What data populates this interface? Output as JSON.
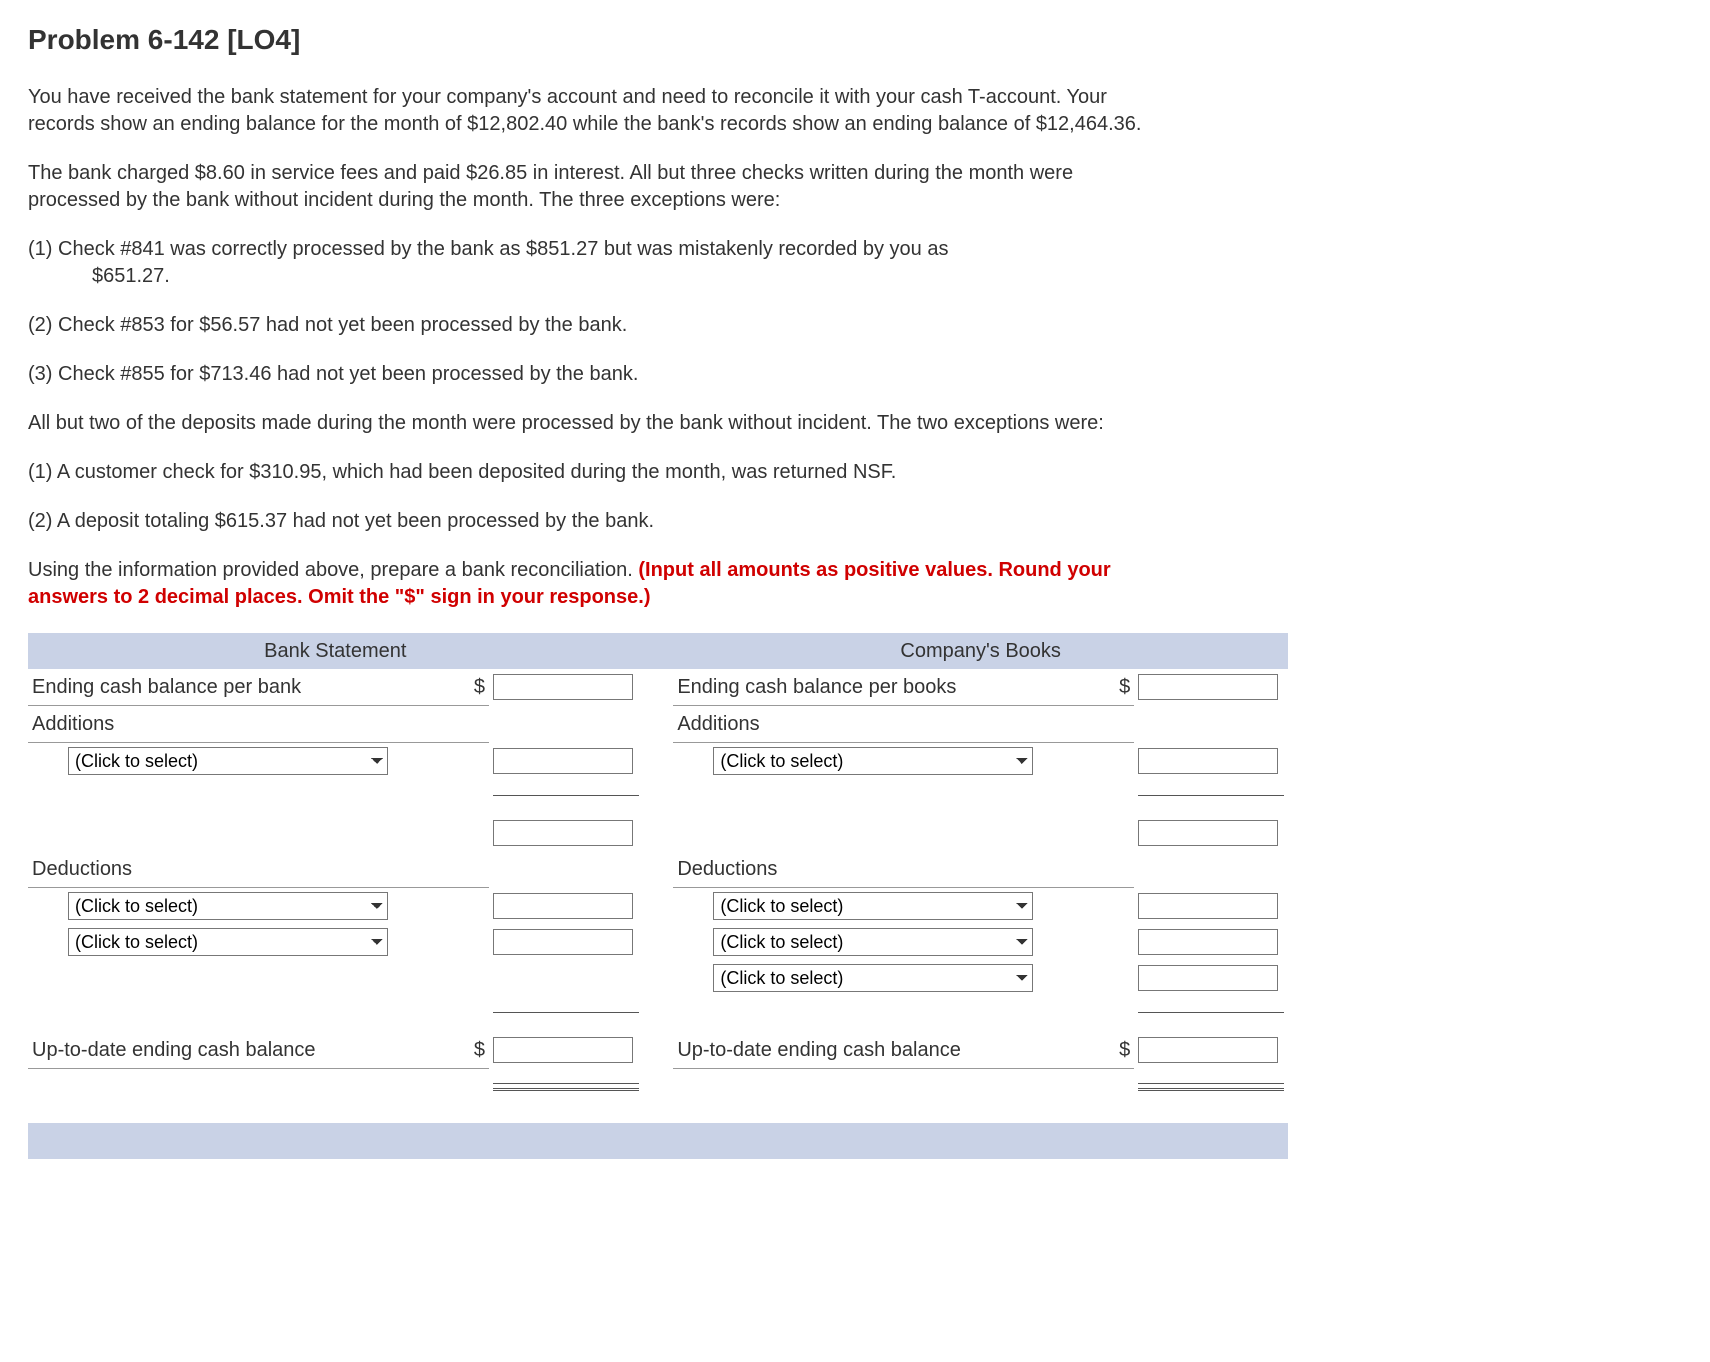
{
  "title": "Problem 6-142 [LO4]",
  "paragraphs": {
    "p1": "You have received the bank statement for your company's account and need to reconcile it with your cash T-account. Your records show an ending balance for the month of $12,802.40 while the bank's records show an ending balance of $12,464.36.",
    "p2": "The bank charged $8.60 in service fees and paid $26.85 in interest. All but three checks written during the month were processed by the bank without incident during the month. The three exceptions were:",
    "c1a": "(1) Check #841 was correctly processed by the bank as $851.27 but was mistakenly recorded by you as",
    "c1b": "$651.27.",
    "c2": "(2) Check #853 for $56.57 had not yet been processed by the bank.",
    "c3": "(3) Check #855 for $713.46 had not yet been processed by the bank.",
    "p3": "All but two of the deposits made during the month were processed by the bank without incident. The two exceptions were:",
    "d1": "(1) A customer check for $310.95, which had been deposited during the month, was returned NSF.",
    "d2": "(2) A deposit totaling $615.37 had not yet been processed by the bank.",
    "p4a": "Using the information provided above, prepare a bank reconciliation. ",
    "p4b": "(Input all amounts as positive values. Round your answers to 2 decimal places. Omit the \"$\" sign in your response.)"
  },
  "table": {
    "header_bank": "Bank Statement",
    "header_books": "Company's Books",
    "ending_bank": "Ending cash balance per bank",
    "ending_books": "Ending cash balance per books",
    "additions": "Additions",
    "deductions": "Deductions",
    "uptodate": "Up-to-date ending cash balance",
    "select_placeholder": "(Click to select)",
    "dollar": "$"
  }
}
